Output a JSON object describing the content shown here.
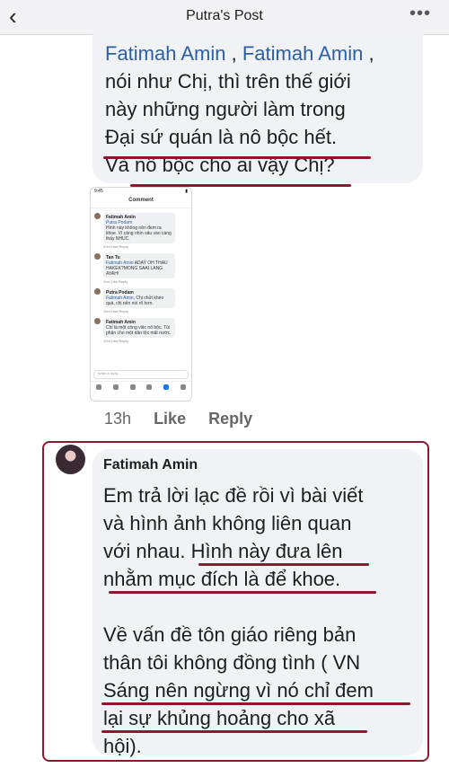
{
  "header": {
    "title": "Putra's Post",
    "back_glyph": "‹",
    "more_glyph": "•••"
  },
  "comment1": {
    "mention1": "Fatimah Amin",
    "after_mention1": " , ",
    "mention2": "Fatimah Amin",
    "after_mention2": " ,",
    "line2": "nói như Chị, thì trên thế giới",
    "line3": "này những người làm trong",
    "line4": "Đại sứ quán là nô bộc hết.",
    "line5": "Và nô bộc cho ai vậy Chị?"
  },
  "thumbnail": {
    "time": "9:45",
    "title": "Comment",
    "comments": [
      {
        "name": "Fatimah Amin",
        "mention": "Putra Podam",
        "text": "Hình này không nên đem ra khoe. Vì càng nhìn sâu vào càng thấy NHỤC.",
        "meta": "20m  Like  Reply"
      },
      {
        "name": "Tan Tu",
        "mention": "Fatimah Amin",
        "text": "ADAY OH THAU HAKEK?MONG SAAI LANG AYAH!",
        "meta": "11m  Like  Reply"
      },
      {
        "name": "Putra Podam",
        "mention": "Fatimah Amin",
        "text": ", Chị chửi khéo quá, chị nên nói rõ hơn.",
        "meta": "10m  Like  Reply"
      },
      {
        "name": "Fatimah Amin",
        "mention": "",
        "text": "Chỉ là một công việc nô bộc. Tùi phận cho một dân tộc mất nước.",
        "meta": "10m  Like  Reply"
      }
    ],
    "reply_placeholder": "Write a reply..."
  },
  "actions": {
    "time": "13h",
    "like": "Like",
    "reply": "Reply"
  },
  "comment2": {
    "author": "Fatimah Amin",
    "lines1": [
      "Em trả lời lạc đề rồi vì bài viết",
      "và hình ảnh không liên quan",
      "với nhau. Hình này đưa lên",
      "nhằm mục đích là để khoe."
    ],
    "lines2": [
      "Về vấn đề tôn giáo riêng bản",
      "thân tôi không đồng tình ( VN",
      "Sáng nên ngừng vì nó chỉ đem",
      "lại sự khủng hoảng cho xã",
      "hội)."
    ]
  },
  "colors": {
    "highlight": "#8b1a2e",
    "mention": "#2d5fa8",
    "bubble": "#f0f2f5"
  }
}
